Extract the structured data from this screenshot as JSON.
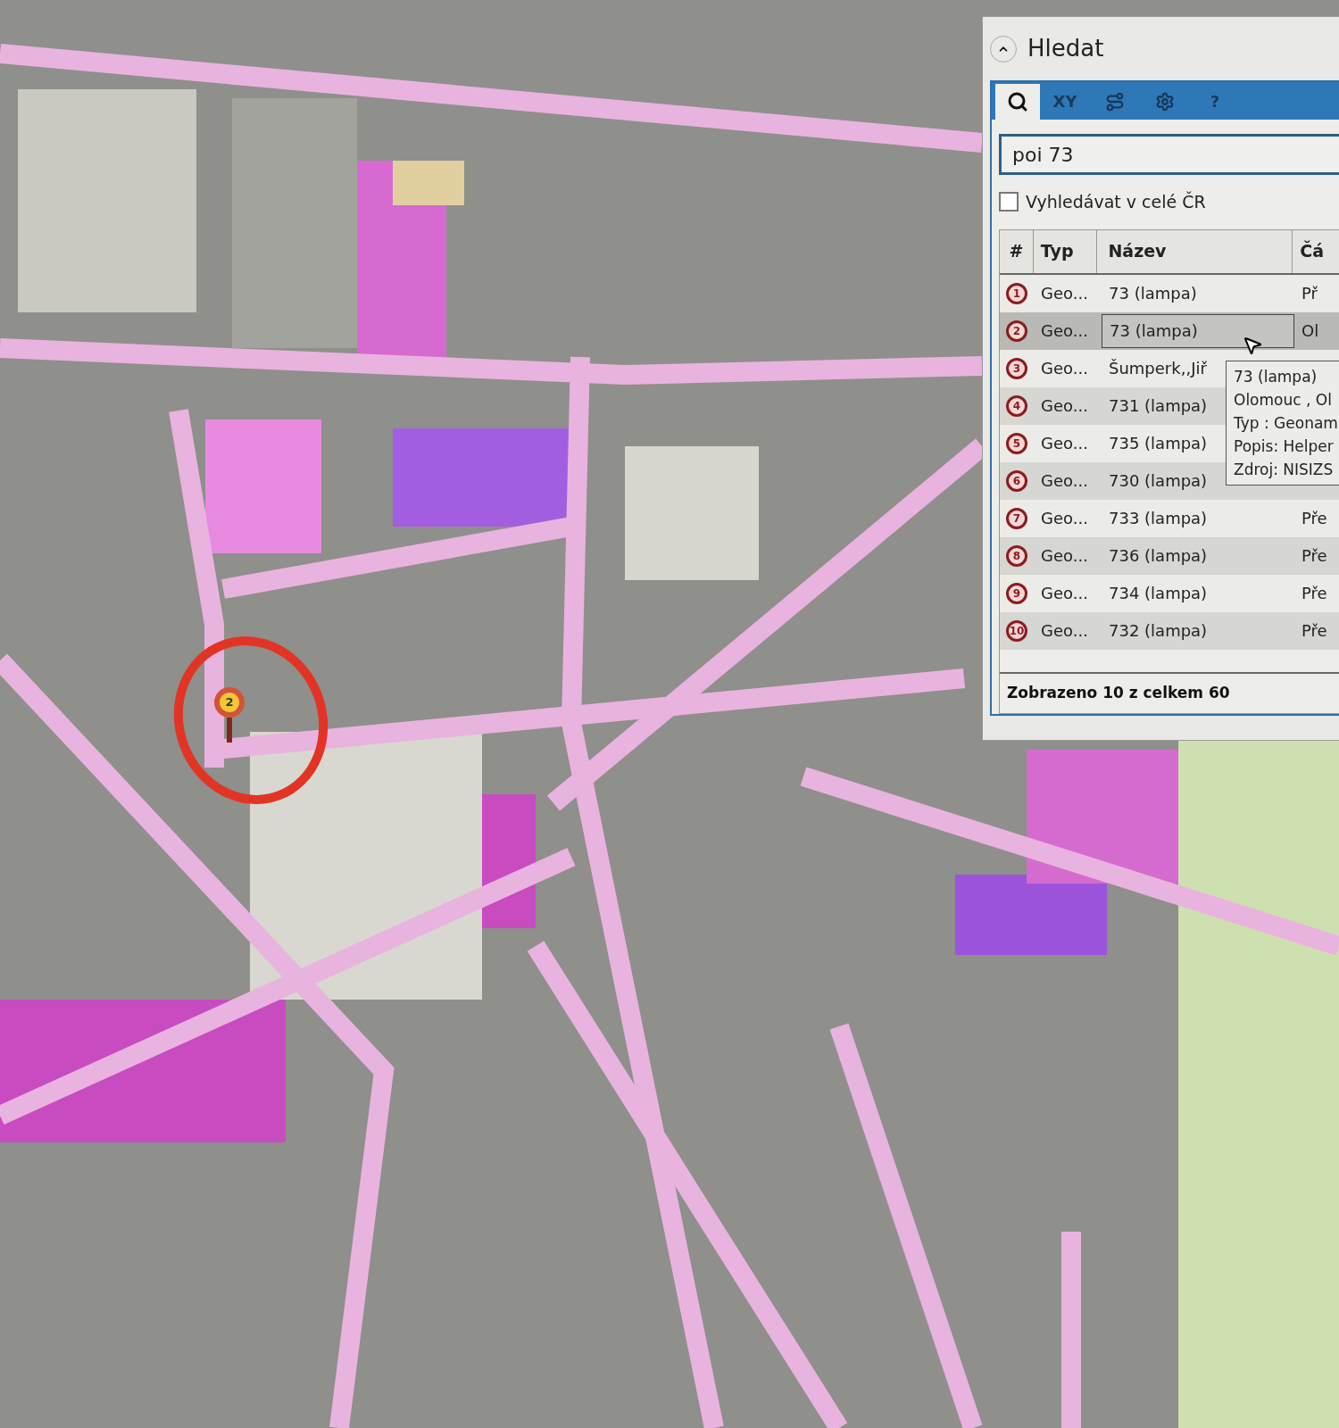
{
  "map": {
    "marker": {
      "label": "2"
    }
  },
  "search_panel": {
    "title": "Hledat",
    "tabs": [
      {
        "kind": "search",
        "selected": true
      },
      {
        "kind": "text",
        "label": "XY",
        "selected": false
      },
      {
        "kind": "route",
        "selected": false
      },
      {
        "kind": "settings",
        "selected": false
      },
      {
        "kind": "text",
        "label": "?",
        "selected": false
      }
    ],
    "query": "poi 73",
    "option": {
      "label": "Vyhledávat v celé ČR",
      "checked": false
    },
    "table": {
      "columns": [
        "#",
        "Typ",
        "Název",
        "Čá"
      ],
      "rows": [
        {
          "number": "1",
          "type": "Geo...",
          "name": "73 (lampa)",
          "column_4": "Př",
          "selected": false
        },
        {
          "number": "2",
          "type": "Geo...",
          "name": "73 (lampa)",
          "column_4": "Ol",
          "selected": true
        },
        {
          "number": "3",
          "type": "Geo...",
          "name": "Šumperk,,Jiř",
          "selected": false
        },
        {
          "number": "4",
          "type": "Geo...",
          "name": "731 (lampa)",
          "selected": false
        },
        {
          "number": "5",
          "type": "Geo...",
          "name": "735 (lampa)",
          "selected": false
        },
        {
          "number": "6",
          "type": "Geo...",
          "name": "730 (lampa)",
          "selected": false
        },
        {
          "number": "7",
          "type": "Geo...",
          "name": "733 (lampa)",
          "column_4": "Pře",
          "selected": false
        },
        {
          "number": "8",
          "type": "Geo...",
          "name": "736 (lampa)",
          "column_4": "Pře",
          "selected": false
        },
        {
          "number": "9",
          "type": "Geo...",
          "name": "734 (lampa)",
          "column_4": "Pře",
          "selected": false
        },
        {
          "number": "10",
          "type": "Geo...",
          "name": "732 (lampa)",
          "column_4": "Pře",
          "selected": false
        }
      ]
    },
    "tooltip": [
      "73 (lampa)",
      "Olomouc , Ol",
      "Typ : Geonam",
      "Popis: Helper",
      "Zdroj: NISIZS"
    ],
    "status": "Zobrazeno 10 z celkem 60"
  }
}
